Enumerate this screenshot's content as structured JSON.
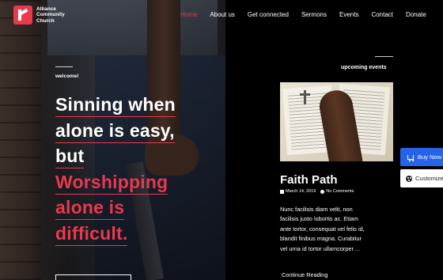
{
  "header": {
    "logo_text": "Alliance Community Church",
    "nav": [
      "Home",
      "About us",
      "Get connected",
      "Sermons",
      "Events",
      "Contact",
      "Donate"
    ],
    "active_nav": "Home"
  },
  "hero": {
    "welcome": "welcome!",
    "headline_line1": "Sinning when",
    "headline_line2": "alone is easy,",
    "headline_line3": "but",
    "headline_line4": "Worshipping",
    "headline_line5": "alone is",
    "headline_line6": "difficult."
  },
  "events": {
    "section_title": "upcoming events",
    "event_title": "Faith Path",
    "event_date": "March 14, 2019",
    "event_comments": "No Comments",
    "excerpt": "Nunc facilisis diam velit, non facilisis justo lobortis ac. Etiam ante tortor, consequat vel felis id, blandit finibus magna. Curabitur vel urna id tortor ullamcorper ...",
    "read_more": "Continue Reading"
  },
  "floating": {
    "buy_label": "Buy Now",
    "customize_label": "Customize"
  },
  "colors": {
    "accent": "#e8394f",
    "buy_button": "#2563eb",
    "background": "#000000"
  },
  "icons": {
    "date": "calendar-icon",
    "comments": "user-icon",
    "buy": "cart-icon",
    "customize": "palette-icon"
  }
}
